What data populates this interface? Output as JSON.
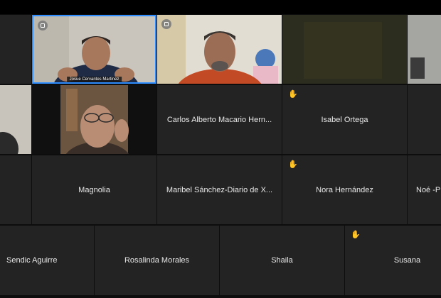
{
  "participants": {
    "josue": {
      "caption": "Josue Cervantes Martinez"
    },
    "carlos": {
      "name": "Carlos Alberto Macario Hern..."
    },
    "isabel": {
      "name": "Isabel Ortega"
    },
    "magnolia": {
      "name": "Magnolia"
    },
    "maribel": {
      "name": "Maribel Sánchez-Diario de X..."
    },
    "nora": {
      "name": "Nora Hernández"
    },
    "noe": {
      "name": "Noé -P"
    },
    "sendic": {
      "name": "Sendic Aguirre"
    },
    "rosalinda": {
      "name": "Rosalinda Morales"
    },
    "shaila": {
      "name": "Shaila"
    },
    "susana": {
      "name": "Susana"
    }
  },
  "icons": {
    "raised_hand": "raised-hand-icon",
    "camera_badge": "camera-badge-icon"
  },
  "colors": {
    "active_speaker_border": "#2d8cff",
    "tile_bg": "#232323",
    "hand": "#f4b400"
  }
}
